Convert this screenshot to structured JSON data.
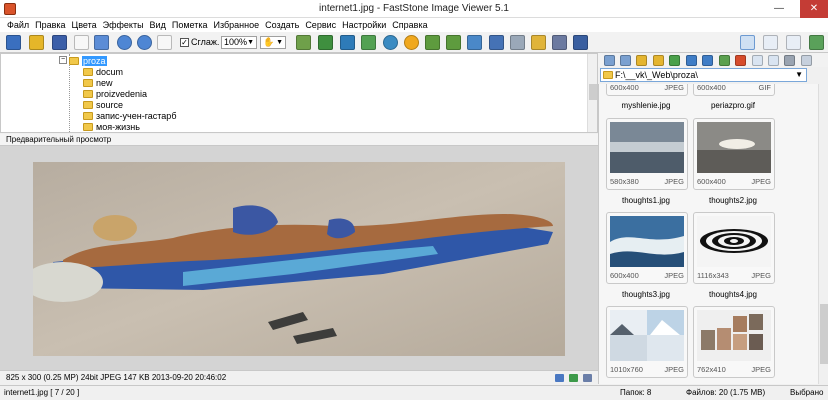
{
  "window": {
    "title": "internet1.jpg  -  FastStone Image Viewer 5.1",
    "minimize": "—",
    "close": "✕"
  },
  "menu": [
    "Файл",
    "Правка",
    "Цвета",
    "Эффекты",
    "Вид",
    "Пометка",
    "Избранное",
    "Создать",
    "Сервис",
    "Настройки",
    "Справка"
  ],
  "toolbar": {
    "smooth_label": "Сглаж.",
    "smooth_checked": "✓",
    "zoom_value": "100%"
  },
  "tree": {
    "expander": "−",
    "items": [
      {
        "label": "proza",
        "selected": true
      },
      {
        "label": "docum"
      },
      {
        "label": "new"
      },
      {
        "label": "proizvedenia"
      },
      {
        "label": "source"
      },
      {
        "label": "запис-учен-гастарб"
      },
      {
        "label": "моя-жизнь"
      }
    ]
  },
  "preview": {
    "header": "Предварительный просмотр"
  },
  "image_info": {
    "text": "825 x 300 (0.25 MP)   24bit   JPEG    147 KB    2013-09-20 20:46:02"
  },
  "bottom_status": {
    "file": "internet1.jpg [ 7 / 20 ]",
    "folders": "Папок: 8",
    "files": "Файлов: 20 (1.75 MB)",
    "selected": "Выбрано"
  },
  "path": {
    "value": "F:\\__vk\\_Web\\proza\\"
  },
  "thumbnails": [
    {
      "name": "myshlenie.jpg",
      "dims": "600x400",
      "format": "JPEG"
    },
    {
      "name": "periazpro.gif",
      "dims": "600x400",
      "format": "GIF"
    },
    {
      "name": "thoughts1.jpg",
      "dims": "580x380",
      "format": "JPEG"
    },
    {
      "name": "thoughts2.jpg",
      "dims": "600x400",
      "format": "JPEG"
    },
    {
      "name": "thoughts3.jpg",
      "dims": "600x400",
      "format": "JPEG"
    },
    {
      "name": "thoughts4.jpg",
      "dims": "1116x343",
      "format": "JPEG"
    },
    {
      "name": "",
      "dims": "1010x760",
      "format": "JPEG"
    },
    {
      "name": "",
      "dims": "762x410",
      "format": "JPEG"
    }
  ]
}
